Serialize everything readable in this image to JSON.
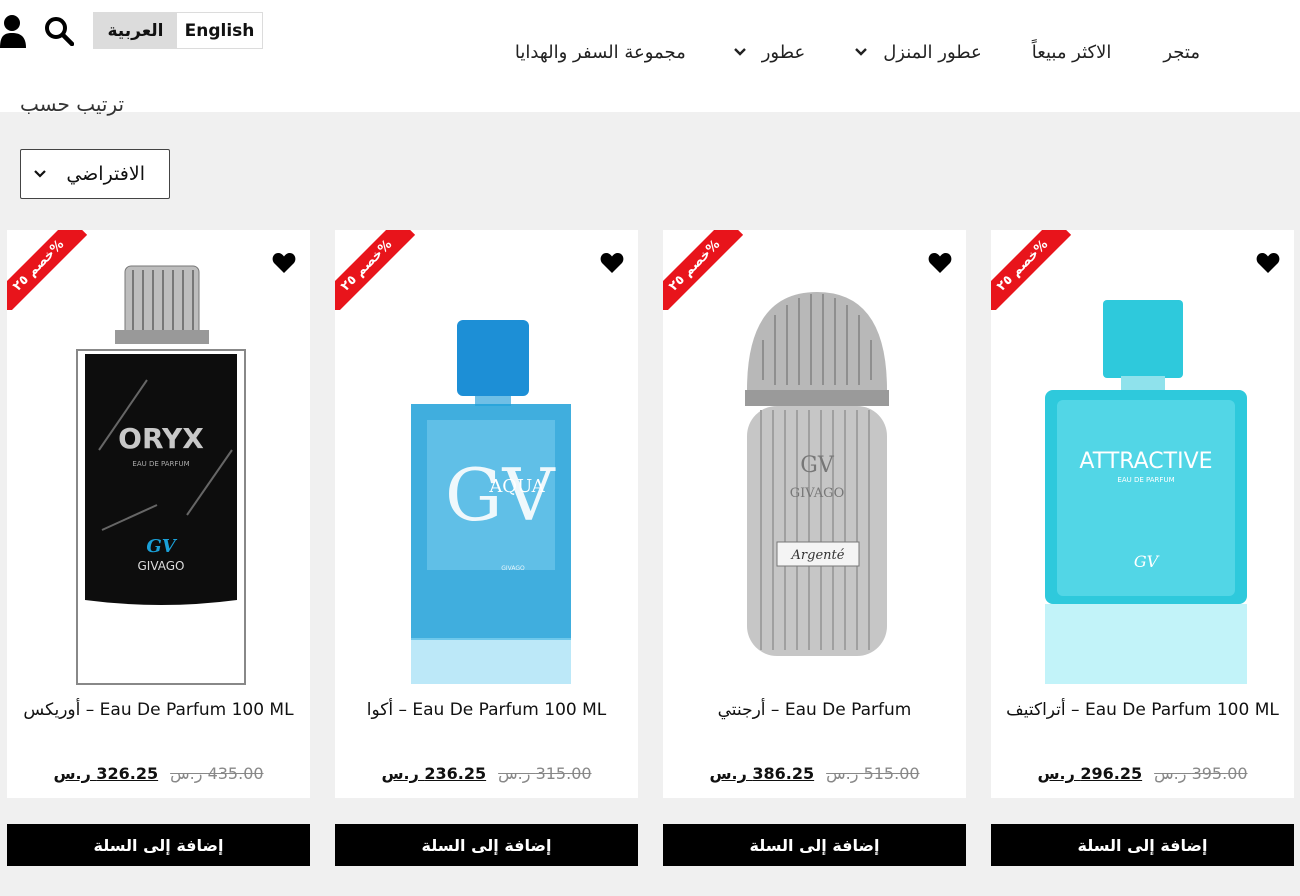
{
  "header": {
    "lang_ar": "العربية",
    "lang_en": "English",
    "nav": {
      "shop": "متجر",
      "best": "الاكثر مبيعاً",
      "home_fragrance": "عطور المنزل",
      "perfumes": "عطور",
      "travel": "مجموعة السفر والهدايا"
    }
  },
  "sort": {
    "label": "ترتيب حسب",
    "selected": "الافتراضي"
  },
  "products": [
    {
      "title": "Eau De Parfum 100 ML – أوريكس",
      "new_price": "326.25 ر.س",
      "old_price": "435.00 ر.س",
      "badge": "خصم ٢٥%",
      "cart": "إضافة إلى السلة",
      "brand": "ORYX",
      "sub": "EAU DE PARFUM",
      "house": "GIVAGO",
      "bottle_color": "#0d0d0d"
    },
    {
      "title": "Eau De Parfum 100 ML – أكوا",
      "new_price": "236.25 ر.س",
      "old_price": "315.00 ر.س",
      "badge": "خصم ٢٥%",
      "cart": "إضافة إلى السلة",
      "brand": "AQUA",
      "house": "GIVAGO",
      "bottle_color": "#1fa0d8"
    },
    {
      "title": "Eau De Parfum – أرجنتي",
      "new_price": "386.25 ر.س",
      "old_price": "515.00 ر.س",
      "badge": "خصم ٢٥%",
      "cart": "إضافة إلى السلة",
      "brand": "Argenté",
      "house": "GIVAGO",
      "bottle_color": "#bdbdbd"
    },
    {
      "title": "Eau De Parfum 100 ML – أتراكتيف",
      "new_price": "296.25 ر.س",
      "old_price": "395.00 ر.س",
      "badge": "خصم ٢٥%",
      "cart": "إضافة إلى السلة",
      "brand": "ATTRACTIVE",
      "sub": "EAU DE PARFUM",
      "bottle_color": "#2ec9dc"
    }
  ]
}
